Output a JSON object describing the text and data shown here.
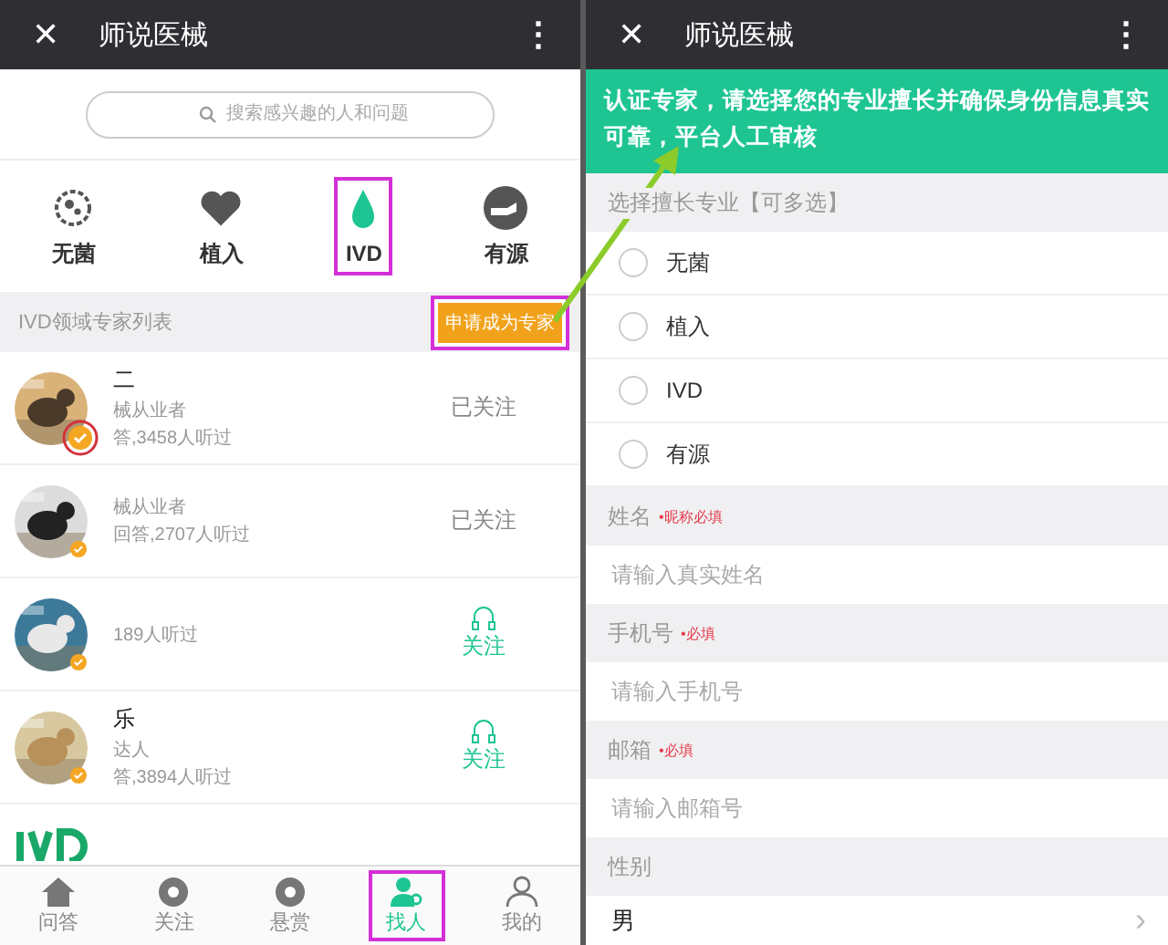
{
  "left": {
    "header": {
      "close": "✕",
      "title": "师说医械",
      "more": "⋮"
    },
    "search": {
      "placeholder": "搜索感兴趣的人和问题"
    },
    "categories": [
      {
        "label": "无菌",
        "selected": false,
        "highlighted": false
      },
      {
        "label": "植入",
        "selected": false,
        "highlighted": false
      },
      {
        "label": "IVD",
        "selected": true,
        "highlighted": true
      },
      {
        "label": "有源",
        "selected": false,
        "highlighted": false
      }
    ],
    "list_header": {
      "title": "IVD领域专家列表",
      "apply_button": "申请成为专家",
      "highlighted": true
    },
    "experts": [
      {
        "name": "二",
        "desc": "械从业者",
        "stats": "答,3458人听过",
        "follow": "已关注",
        "following": true,
        "circled": true
      },
      {
        "desc": "械从业者",
        "stats": "回答,2707人听过",
        "follow": "已关注",
        "following": true,
        "circled": false
      },
      {
        "stats": "189人听过",
        "follow": "关注",
        "following": false,
        "circled": false
      },
      {
        "name": "乐",
        "desc": "达人",
        "stats": "答,3894人听过",
        "follow": "关注",
        "following": false,
        "circled": false
      }
    ],
    "nav": [
      {
        "label": "问答",
        "selected": false,
        "highlighted": false
      },
      {
        "label": "关注",
        "selected": false,
        "highlighted": false
      },
      {
        "label": "悬赏",
        "selected": false,
        "highlighted": false
      },
      {
        "label": "找人",
        "selected": true,
        "highlighted": true
      },
      {
        "label": "我的",
        "selected": false,
        "highlighted": false
      }
    ]
  },
  "right": {
    "header": {
      "close": "✕",
      "title": "师说医械",
      "more": "⋮"
    },
    "banner": "认证专家，请选择您的专业擅长并确保身份信息真实可靠，平台人工审核",
    "specialty_label": "选择擅长专业【可多选】",
    "specialties": [
      {
        "label": "无菌",
        "checked": false
      },
      {
        "label": "植入",
        "checked": false
      },
      {
        "label": "IVD",
        "checked": false
      },
      {
        "label": "有源",
        "checked": false
      }
    ],
    "fields": [
      {
        "label": "姓名",
        "required": "•昵称必填",
        "placeholder": "请输入真实姓名"
      },
      {
        "label": "手机号",
        "required": "•必填",
        "placeholder": "请输入手机号"
      },
      {
        "label": "邮箱",
        "required": "•必填",
        "placeholder": "请输入邮箱号"
      }
    ],
    "gender": {
      "label": "性别",
      "value": "男",
      "chevron": "›"
    }
  }
}
